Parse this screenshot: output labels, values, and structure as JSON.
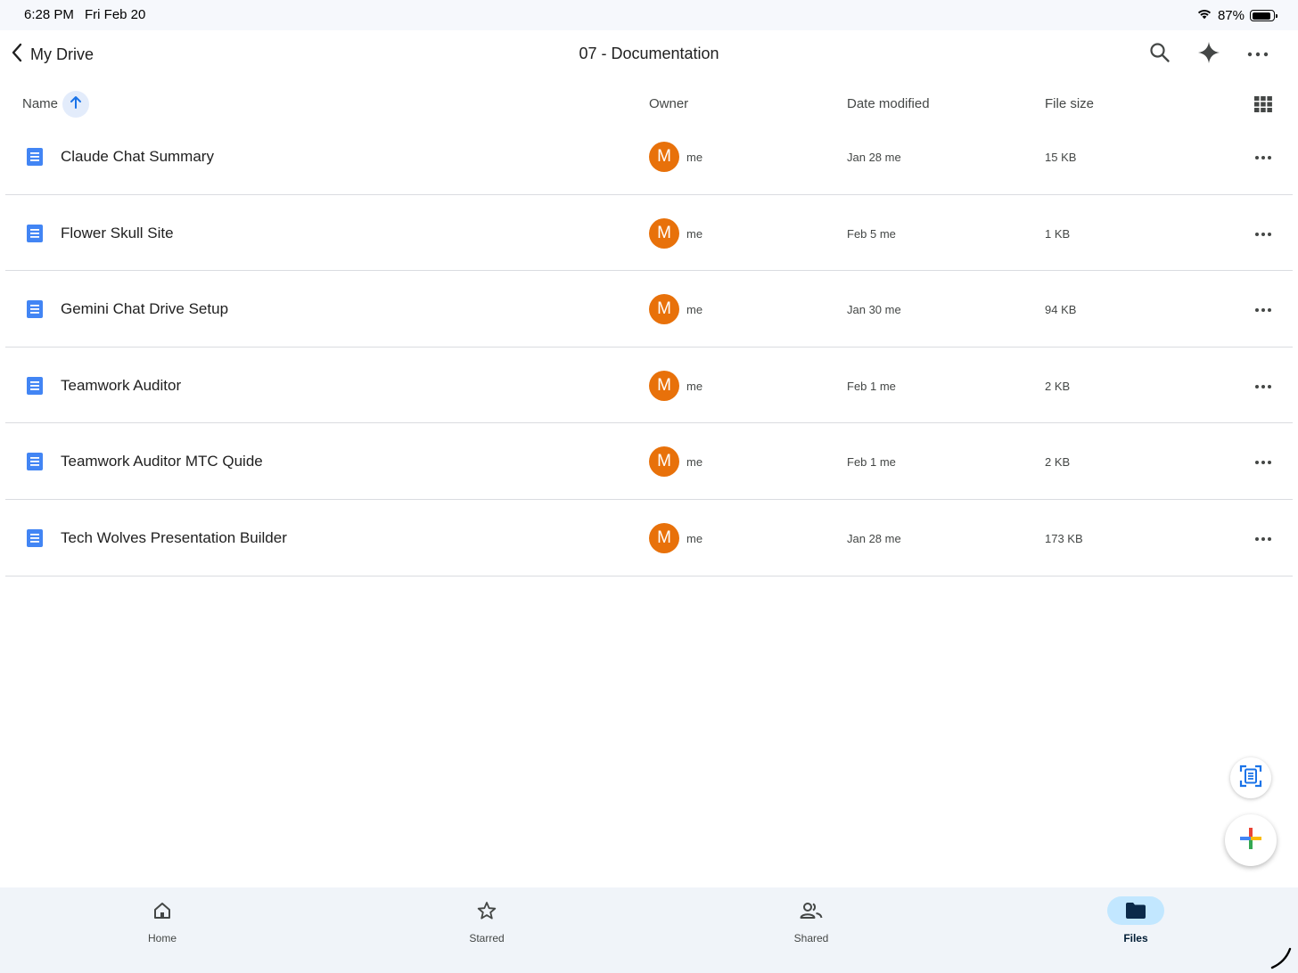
{
  "status_bar": {
    "time": "6:28 PM",
    "date": "Fri Feb 20",
    "battery_text": "87%",
    "battery_level": 0.87,
    "icons": [
      "wifi-icon",
      "battery-icon"
    ]
  },
  "header": {
    "back_label": "My Drive",
    "title": "07 - Documentation",
    "icons": [
      "search-icon",
      "gemini-sparkle-icon",
      "more-icon"
    ]
  },
  "columns": {
    "name": "Name",
    "owner": "Owner",
    "date_modified": "Date modified",
    "file_size": "File size",
    "sort_direction": "ascending"
  },
  "files": [
    {
      "name": "Claude Chat Summary",
      "owner_initial": "M",
      "owner": "me",
      "modified": "Jan 28 me",
      "size": "15 KB"
    },
    {
      "name": "Flower Skull Site",
      "owner_initial": "M",
      "owner": "me",
      "modified": "Feb 5 me",
      "size": "1 KB"
    },
    {
      "name": "Gemini Chat Drive Setup",
      "owner_initial": "M",
      "owner": "me",
      "modified": "Jan 30 me",
      "size": "94 KB"
    },
    {
      "name": "Teamwork Auditor",
      "owner_initial": "M",
      "owner": "me",
      "modified": "Feb 1 me",
      "size": "2 KB"
    },
    {
      "name": "Teamwork Auditor MTC Quide",
      "owner_initial": "M",
      "owner": "me",
      "modified": "Feb 1 me",
      "size": "2 KB"
    },
    {
      "name": "Tech Wolves Presentation Builder",
      "owner_initial": "M",
      "owner": "me",
      "modified": "Jan 28 me",
      "size": "173 KB"
    }
  ],
  "nav": [
    {
      "label": "Home",
      "icon": "home-icon",
      "active": false
    },
    {
      "label": "Starred",
      "icon": "star-icon",
      "active": false
    },
    {
      "label": "Shared",
      "icon": "shared-people-icon",
      "active": false
    },
    {
      "label": "Files",
      "icon": "folder-icon",
      "active": true
    }
  ],
  "colors": {
    "accent": "#1a73e8",
    "avatar": "#e8710a",
    "doc_icon": "#4285f4",
    "nav_active": "#c2e7ff",
    "nav_bg": "#f0f4f9"
  }
}
